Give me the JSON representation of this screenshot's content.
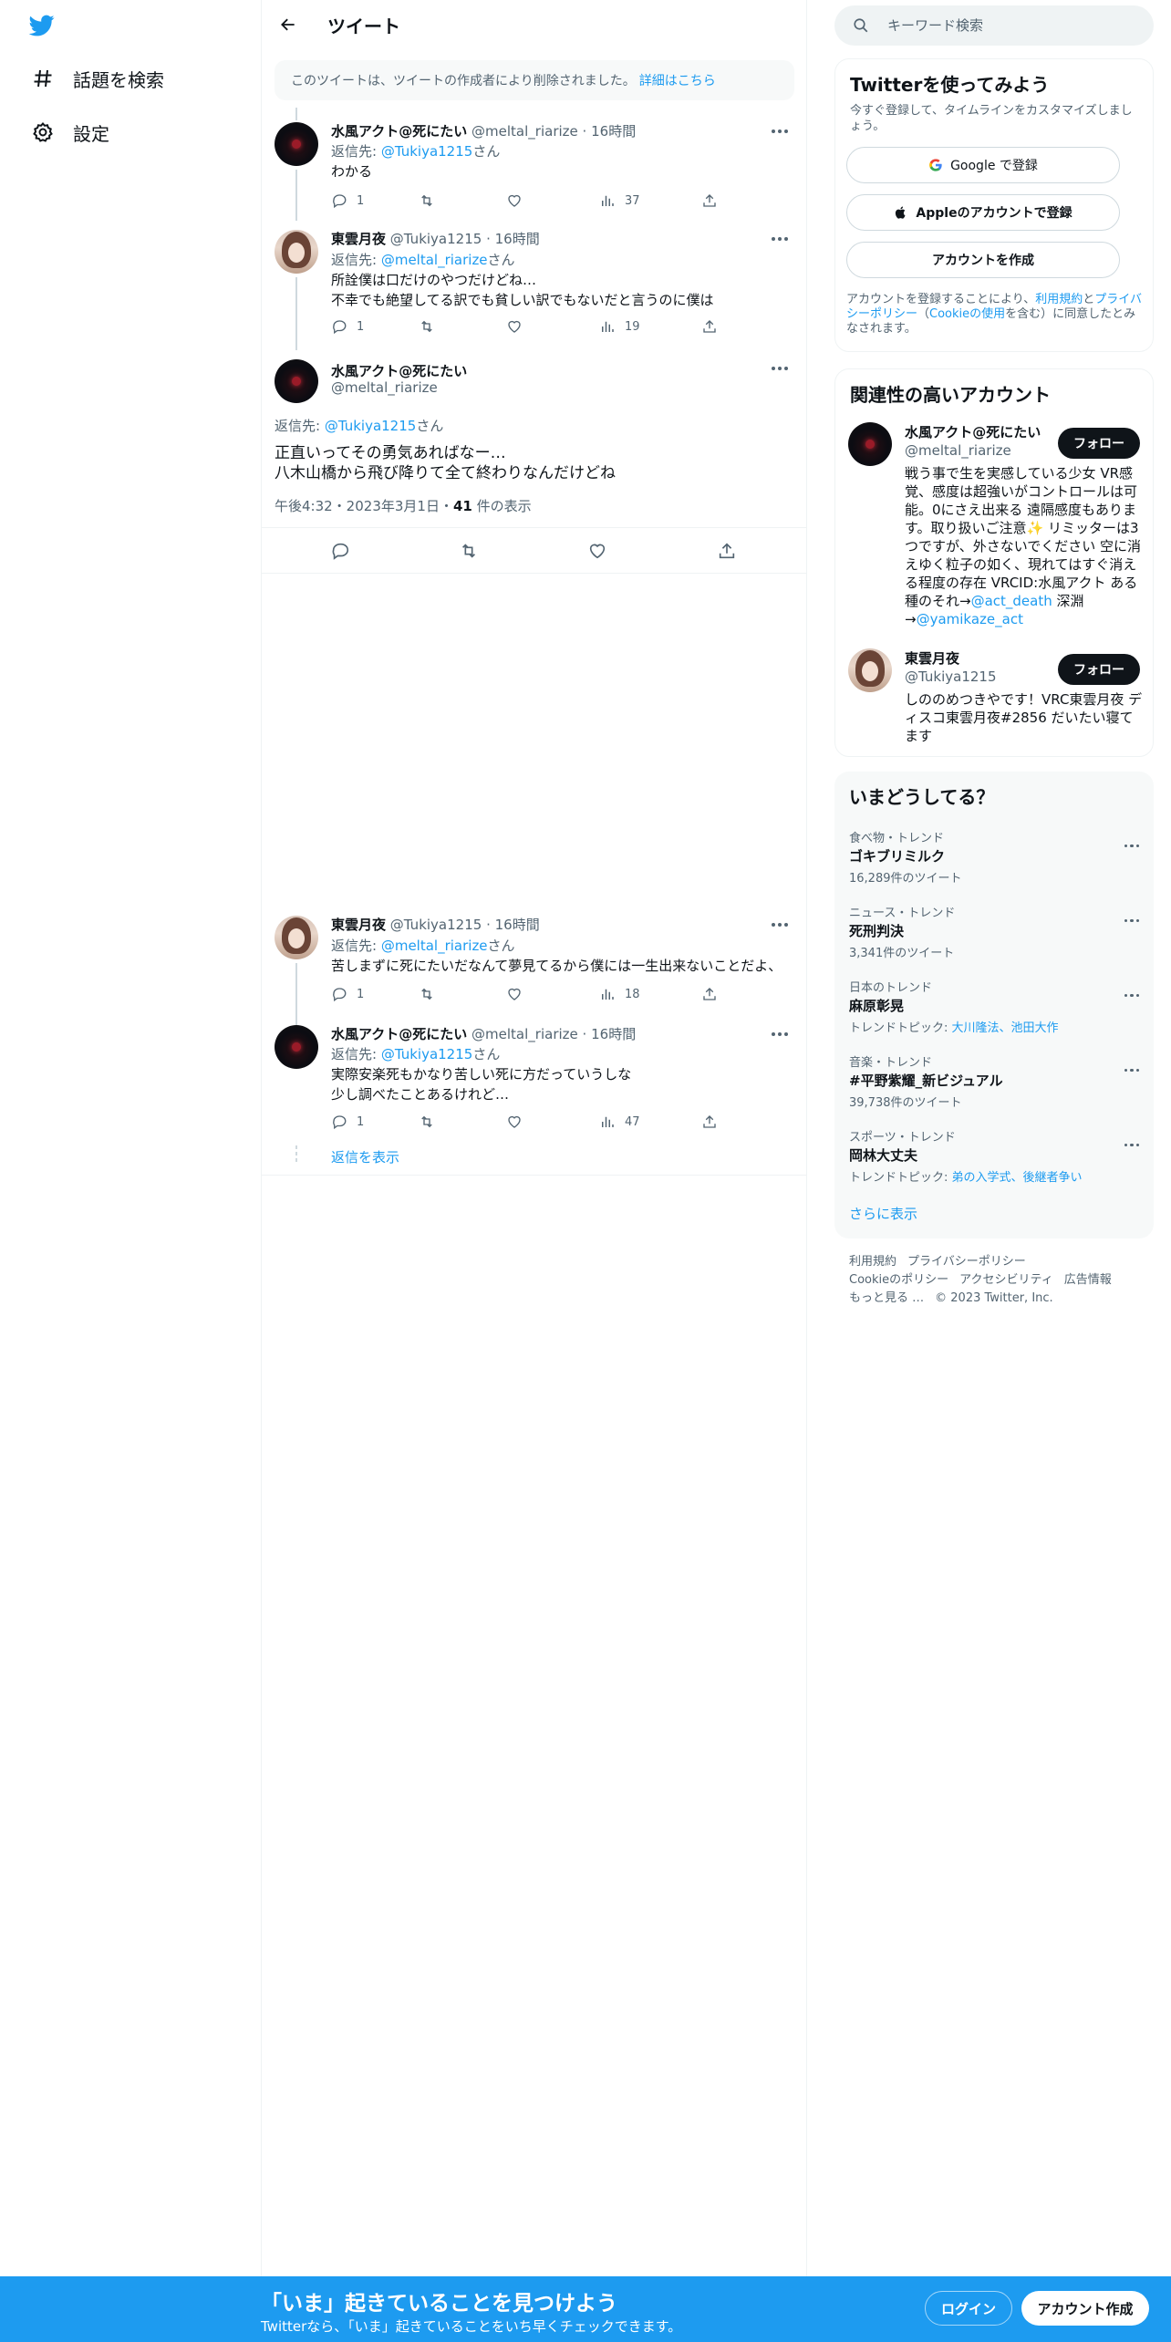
{
  "nav": {
    "explore_label": "話題を検索",
    "settings_label": "設定"
  },
  "header": {
    "title": "ツイート"
  },
  "deleted_notice": {
    "text": "このツイートは、ツイートの作成者により削除されました。",
    "link": "詳細はこちら"
  },
  "tweets": [
    {
      "name": "水風アクト@死にたい",
      "handle": "@meltal_riarize",
      "time": "16時間",
      "reply_prefix": "返信先: ",
      "reply_to": "@Tukiya1215",
      "reply_suffix": "さん",
      "text_lines": [
        "わかる"
      ],
      "replies": "1",
      "views": "37"
    },
    {
      "name": "東雲月夜",
      "handle": "@Tukiya1215",
      "time": "16時間",
      "reply_prefix": "返信先: ",
      "reply_to": "@meltal_riarize",
      "reply_suffix": "さん",
      "text_lines": [
        "所詮僕は口だけのやつだけどね…",
        "不幸でも絶望してる訳でも貧しい訳でもないだと言うのに僕は"
      ],
      "replies": "1",
      "views": "19"
    },
    {
      "name": "東雲月夜",
      "handle": "@Tukiya1215",
      "time": "16時間",
      "reply_prefix": "返信先: ",
      "reply_to": "@meltal_riarize",
      "reply_suffix": "さん",
      "text_lines": [
        "苦しまずに死にたいだなんて夢見てるから僕には一生出来ないことだよ、"
      ],
      "replies": "1",
      "views": "18"
    },
    {
      "name": "水風アクト@死にたい",
      "handle": "@meltal_riarize",
      "time": "16時間",
      "reply_prefix": "返信先: ",
      "reply_to": "@Tukiya1215",
      "reply_suffix": "さん",
      "text_lines": [
        "実際安楽死もかなり苦しい死に方だっていうしな",
        "少し調べたことあるけれど…"
      ],
      "replies": "1",
      "views": "47"
    }
  ],
  "main_tweet": {
    "name": "水風アクト@死にたい",
    "handle": "@meltal_riarize",
    "reply_prefix": "返信先: ",
    "reply_to": "@Tukiya1215",
    "reply_suffix": "さん",
    "text_line1": "正直いってその勇気あればなー…",
    "text_line2": "八木山橋から飛び降りて全て終わりなんだけどね",
    "time": "午後4:32・2023年3月1日・",
    "views": "41",
    "views_label": " 件の表示"
  },
  "show_replies": "返信を表示",
  "search": {
    "placeholder": "キーワード検索"
  },
  "signup_card": {
    "title": "Twitterを使ってみよう",
    "subtitle": "今すぐ登録して、タイムラインをカスタマイズしましょう。",
    "google": "Google で登録",
    "apple": "Appleのアカウントで登録",
    "create": "アカウントを作成",
    "legal_1": "アカウントを登録することにより、",
    "legal_terms": "利用規約",
    "legal_2": "と",
    "legal_privacy": "プライバシーポリシー",
    "legal_3": "（",
    "legal_cookie": "Cookieの使用",
    "legal_4": "を含む）に同意したとみなされます。"
  },
  "relevant": {
    "title": "関連性の高いアカウント",
    "follow_label": "フォロー",
    "accounts": [
      {
        "name": "水風アクト@死にたい",
        "handle": "@meltal_riarize",
        "bio": "戦う事で生を実感している少女 VR感覚、感度は超強いがコントロールは可能。0にさえ出来る 遠隔感度もあります。取り扱いご注意✨ リミッターは3つですが、外さないでください 空に消えゆく粒子の如く、現れてはすぐ消える程度の存在 VRCID:水風アクト ある種のそれ→",
        "bio_link1": "@act_death",
        "bio_mid": " 深淵→",
        "bio_link2": "@yamikaze_act"
      },
      {
        "name": "東雲月夜",
        "handle": "@Tukiya1215",
        "bio": "しののめつきやです！VRC東雲月夜 ディスコ東雲月夜#2856 だいたい寝てます"
      }
    ]
  },
  "trends": {
    "title": "いまどうしてる？",
    "items": [
      {
        "category": "食べ物・トレンド",
        "name": "ゴキブリミルク",
        "sub": "16,289件のツイート"
      },
      {
        "category": "ニュース・トレンド",
        "name": "死刑判決",
        "sub": "3,341件のツイート"
      },
      {
        "category": "日本のトレンド",
        "name": "麻原彰晃",
        "sub_prefix": "トレンドトピック: ",
        "sub_links": "大川隆法、池田大作"
      },
      {
        "category": "音楽・トレンド",
        "name": "#平野紫耀_新ビジュアル",
        "sub": "39,738件のツイート"
      },
      {
        "category": "スポーツ・トレンド",
        "name": "岡林大丈夫",
        "sub_prefix": "トレンドトピック: ",
        "sub_links": "弟の入学式、後継者争い"
      }
    ],
    "show_more": "さらに表示"
  },
  "footer": {
    "terms": "利用規約",
    "privacy": "プライバシーポリシー",
    "cookie": "Cookieのポリシー",
    "accessibility": "アクセシビリティ",
    "ads": "広告情報",
    "more": "もっと見る …",
    "copyright": "© 2023 Twitter, Inc."
  },
  "bottom_bar": {
    "title": "「いま」起きていることを見つけよう",
    "subtitle": "Twitterなら、「いま」起きていることをいち早くチェックできます。",
    "login": "ログイン",
    "signup": "アカウント作成"
  },
  "colors": {
    "brand": "#1d9bf0",
    "text": "#0f1419",
    "secondary": "#536471"
  }
}
